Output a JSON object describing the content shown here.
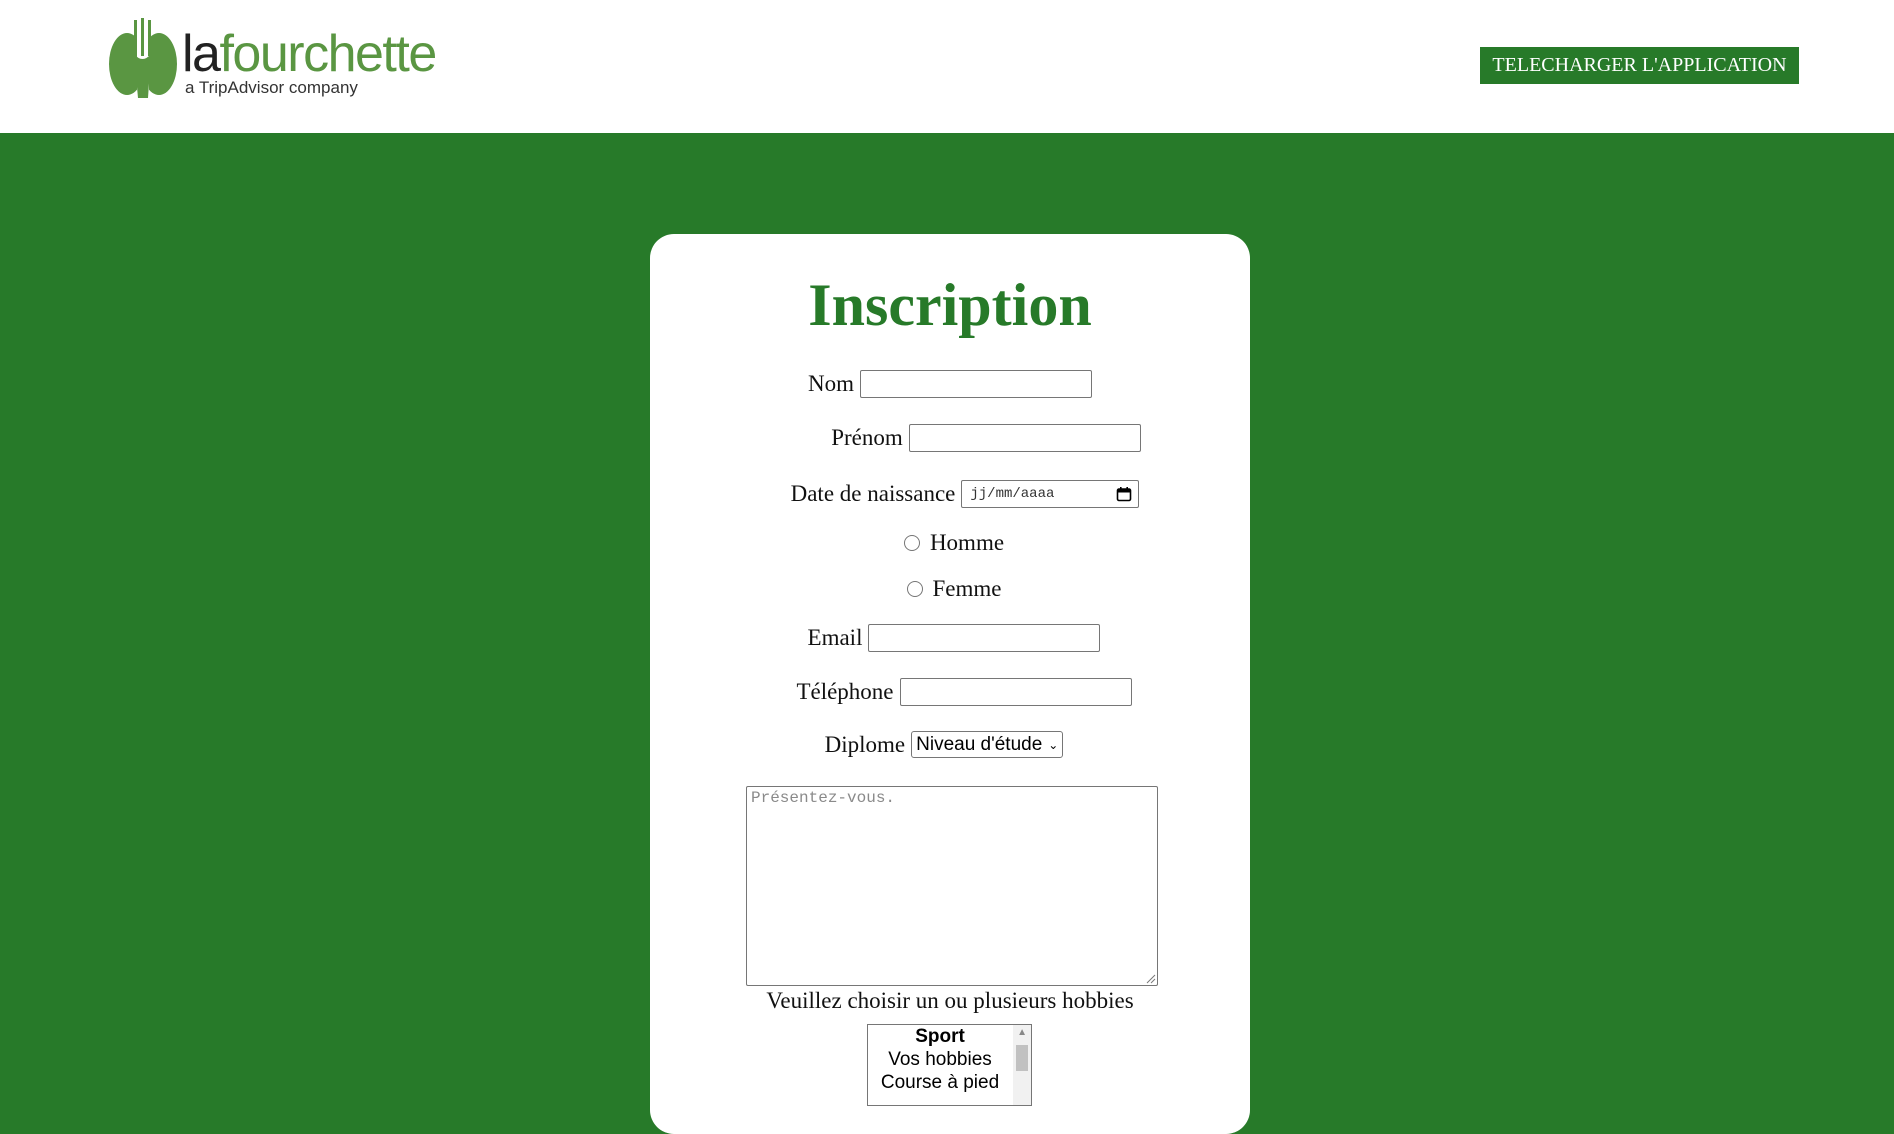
{
  "header": {
    "logo": {
      "word_la": "la",
      "word_fourchette": "fourchette",
      "tagline": "a TripAdvisor company"
    },
    "download_button_label": "TELECHARGER L'APPLICATION"
  },
  "form": {
    "title": "Inscription",
    "nom_label": "Nom",
    "prenom_label": "Prénom",
    "birthdate_label": "Date de naissance",
    "birthdate_placeholder": "jj/mm/aaaa",
    "gender_options": [
      "Homme",
      "Femme"
    ],
    "email_label": "Email",
    "telephone_label": "Téléphone",
    "diplome_label": "Diplome",
    "diplome_selected": "Niveau d'étude",
    "presentation_placeholder": "Présentez-vous.",
    "hobbies_label": "Veuillez choisir un ou plusieurs hobbies",
    "hobbies_list": {
      "group_label": "Sport",
      "options": [
        "Vos hobbies",
        "Course à pied"
      ]
    }
  },
  "colors": {
    "brand_green": "#277a29",
    "logo_green": "#5a9642",
    "card_background": "#ffffff"
  }
}
